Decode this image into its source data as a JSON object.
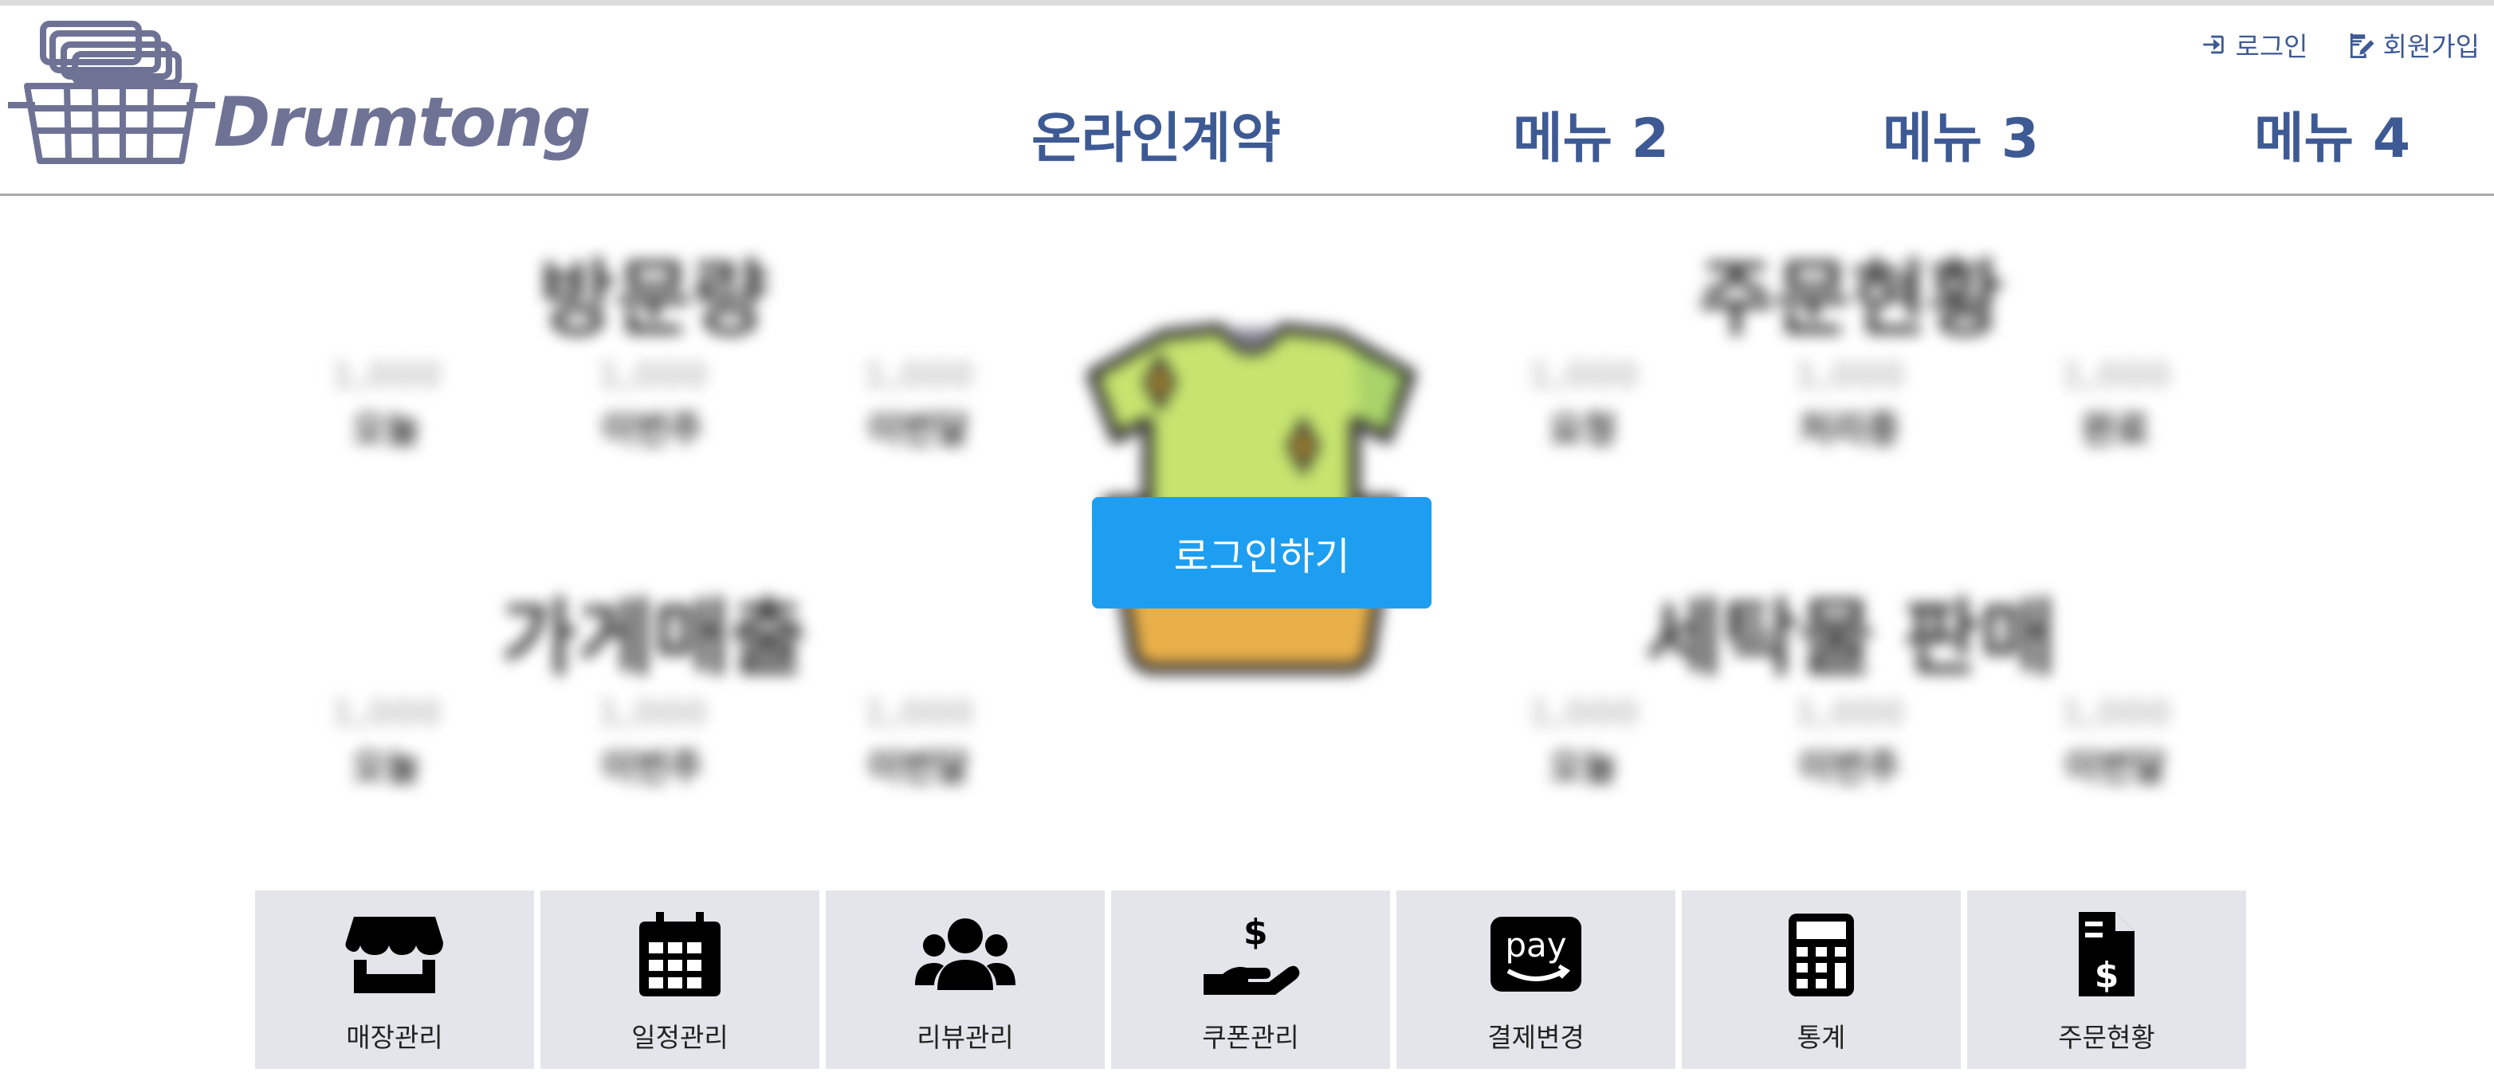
{
  "header": {
    "logo_text": "Drumtong",
    "auth": {
      "login": "로그인",
      "signup": "회원가입"
    },
    "nav": [
      "온라인계약",
      "메뉴 2",
      "메뉴 3",
      "메뉴 4"
    ]
  },
  "dashboard": {
    "panels": [
      {
        "title": "방문량",
        "cells": [
          {
            "value": "1,000",
            "label": "오늘"
          },
          {
            "value": "1,000",
            "label": "이번주"
          },
          {
            "value": "1,000",
            "label": "이번달"
          }
        ]
      },
      {
        "title": "주문현황",
        "cells": [
          {
            "value": "1,000",
            "label": "요청"
          },
          {
            "value": "1,000",
            "label": "처리중"
          },
          {
            "value": "1,000",
            "label": "완료"
          }
        ]
      },
      {
        "title": "가게매출",
        "cells": [
          {
            "value": "1,000",
            "label": "오늘"
          },
          {
            "value": "1,000",
            "label": "이번주"
          },
          {
            "value": "1,000",
            "label": "이번달"
          }
        ]
      },
      {
        "title": "세탁물 판매",
        "cells": [
          {
            "value": "1,000",
            "label": "오늘"
          },
          {
            "value": "1,000",
            "label": "이번주"
          },
          {
            "value": "1,000",
            "label": "이번달"
          }
        ]
      }
    ],
    "login_button": "로그인하기"
  },
  "tiles": [
    {
      "label": "매장관리",
      "icon": "store-icon"
    },
    {
      "label": "일정관리",
      "icon": "calendar-icon"
    },
    {
      "label": "리뷰관리",
      "icon": "users-icon"
    },
    {
      "label": "쿠폰관리",
      "icon": "hand-dollar-icon"
    },
    {
      "label": "결제변경",
      "icon": "amazon-pay-icon"
    },
    {
      "label": "통계",
      "icon": "calculator-icon"
    },
    {
      "label": "주문현황",
      "icon": "invoice-dollar-icon"
    }
  ],
  "colors": {
    "nav": "#3e5a94",
    "logo": "#6e7396",
    "button": "#1e9ef0",
    "tile_bg": "#e4e5ea"
  }
}
